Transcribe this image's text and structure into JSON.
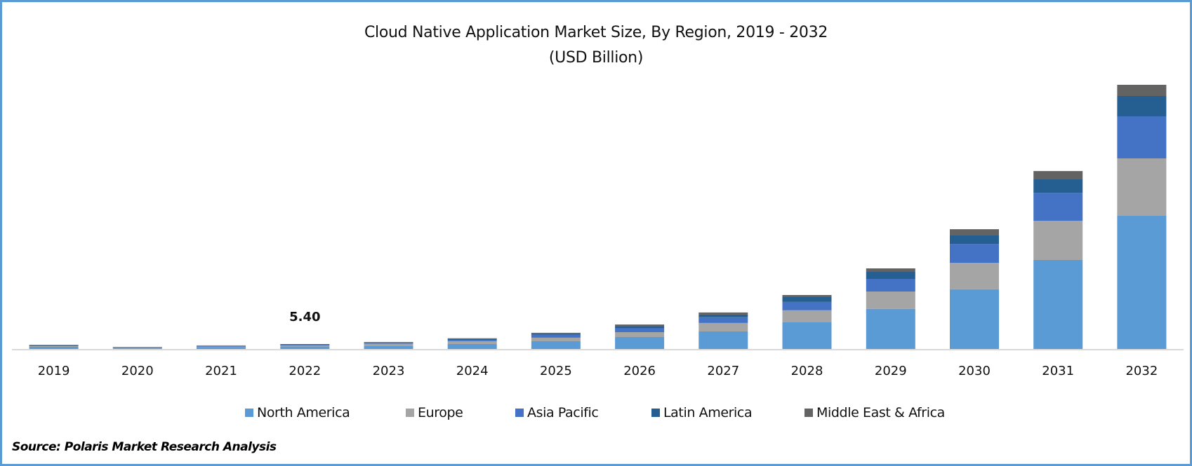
{
  "chart_data": {
    "type": "bar",
    "stacked": true,
    "title": "Cloud Native Application Market Size, By Region, 2019 - 2032",
    "subtitle": "(USD Billion)",
    "xlabel": "",
    "ylabel": "",
    "ylim": [
      0,
      300
    ],
    "grid": false,
    "legend_position": "bottom",
    "categories": [
      "2019",
      "2020",
      "2021",
      "2022",
      "2023",
      "2024",
      "2025",
      "2026",
      "2027",
      "2028",
      "2029",
      "2030",
      "2031",
      "2032"
    ],
    "series": [
      {
        "name": "North America",
        "color": "#5B9BD5",
        "values": [
          2.3,
          1.2,
          1.9,
          2.6,
          3.1,
          5.4,
          8.5,
          13.1,
          19.3,
          29.3,
          44.2,
          65.8,
          97.9,
          146.5
        ]
      },
      {
        "name": "Europe",
        "color": "#A5A5A5",
        "values": [
          0.8,
          0.4,
          0.7,
          1.0,
          2.6,
          3.1,
          3.9,
          5.4,
          9.3,
          13.4,
          19.0,
          29.0,
          43.2,
          63.2
        ]
      },
      {
        "name": "Asia Pacific",
        "color": "#4472C4",
        "values": [
          0.8,
          0.3,
          0.6,
          0.9,
          1.0,
          1.5,
          3.1,
          4.6,
          6.2,
          9.0,
          13.9,
          20.8,
          30.8,
          46.3
        ]
      },
      {
        "name": "Latin America",
        "color": "#255E91",
        "values": [
          0.4,
          0.2,
          0.4,
          0.5,
          0.5,
          1.0,
          1.3,
          2.3,
          3.1,
          5.4,
          7.7,
          10.0,
          15.4,
          22.4
        ]
      },
      {
        "name": "Middle East & Africa",
        "color": "#636363",
        "values": [
          0.3,
          0.2,
          0.3,
          0.4,
          0.5,
          0.8,
          1.0,
          1.5,
          2.3,
          2.3,
          3.9,
          6.2,
          8.5,
          12.3
        ]
      }
    ],
    "annotations": [
      {
        "category": "2022",
        "text": "5.40"
      }
    ]
  },
  "source": "Source: Polaris Market Research Analysis",
  "colors": {
    "frame_border": "#5B9BD5",
    "axis_line": "#D9D9D9"
  }
}
